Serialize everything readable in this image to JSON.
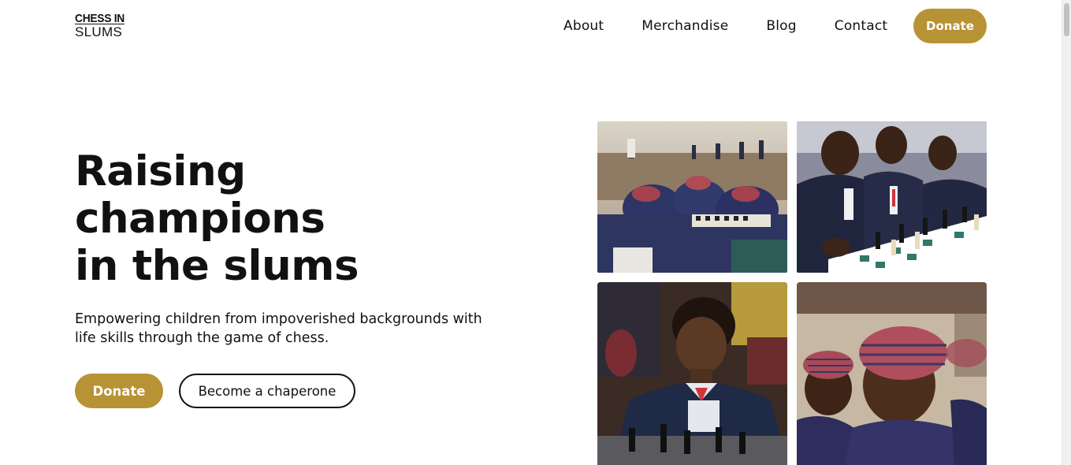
{
  "header": {
    "logo_line1": "CHESS IN",
    "logo_line2": "SLUMS",
    "nav": [
      {
        "label": "About"
      },
      {
        "label": "Merchandise"
      },
      {
        "label": "Blog"
      },
      {
        "label": "Contact"
      }
    ],
    "donate_label": "Donate"
  },
  "hero": {
    "title_lines": [
      "Raising",
      "champions",
      "in the slums"
    ],
    "description": "Empowering children from impoverished backgrounds with life skills through the game of chess.",
    "primary_button": "Donate",
    "secondary_button": "Become a chaperone"
  },
  "colors": {
    "accent": "#b89335",
    "text": "#111111",
    "background": "#ffffff"
  }
}
